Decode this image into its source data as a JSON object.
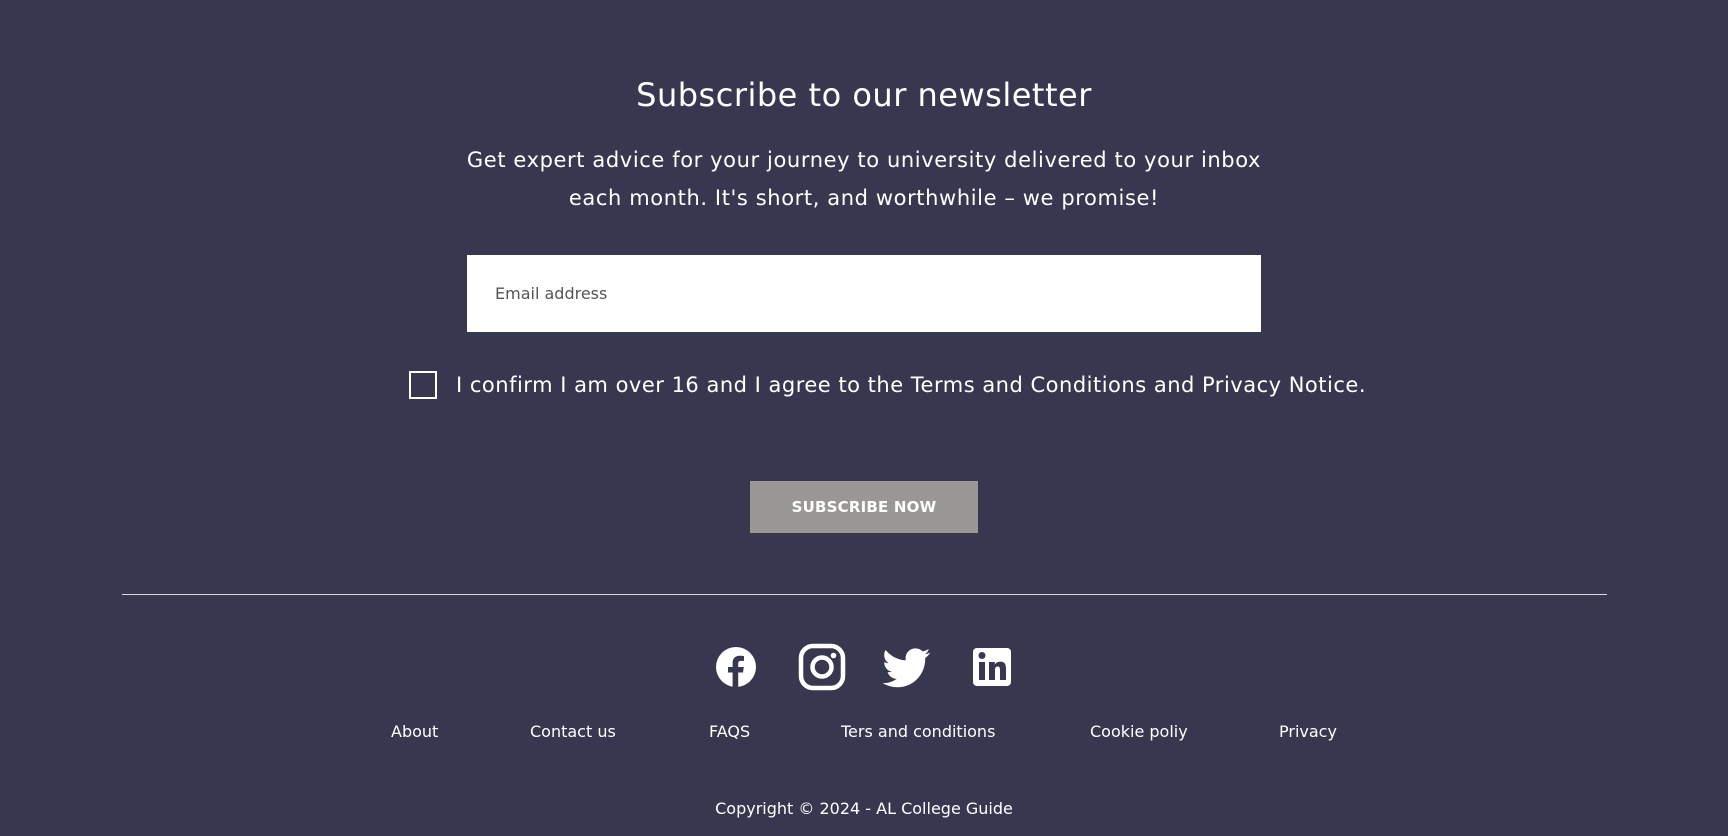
{
  "newsletter": {
    "title": "Subscribe to our newsletter",
    "description": "Get expert advice for your journey to university delivered to your inbox each month. It's short, and worthwhile – we promise!",
    "email_placeholder": "Email address",
    "email_value": "",
    "consent_text": "I confirm I am over 16 and I agree to the Terms and Conditions and Privacy Notice.",
    "consent_checked": false,
    "button_label": "SUBSCRIBE NOW"
  },
  "social": [
    {
      "icon": "facebook-icon"
    },
    {
      "icon": "instagram-icon"
    },
    {
      "icon": "twitter-icon"
    },
    {
      "icon": "linkedin-icon"
    }
  ],
  "footer": {
    "links": [
      {
        "label": "About"
      },
      {
        "label": "Contact us"
      },
      {
        "label": "FAQS"
      },
      {
        "label": "Ters and conditions"
      },
      {
        "label": "Cookie poliy"
      },
      {
        "label": "Privacy"
      }
    ],
    "copyright": "Copyright © 2024 - AL College Guide"
  },
  "colors": {
    "background": "#37384f",
    "text": "#ffffff",
    "button": "#9a9894",
    "input_background": "#ffffff"
  }
}
